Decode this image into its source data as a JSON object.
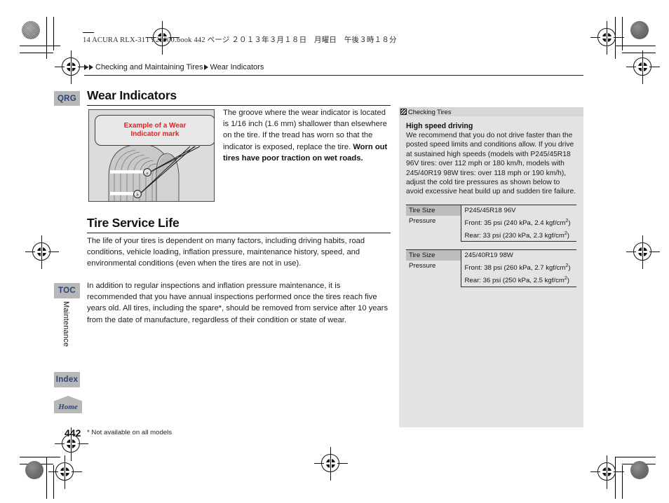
{
  "document": {
    "file_header": "14 ACURA RLX-31TY26000.book   442 ページ   ２０１３年３月１８日　月曜日　午後３時１８分",
    "page_number": "442",
    "footnote": "* Not available on all models",
    "vertical_tab": "Maintenance"
  },
  "breadcrumb": {
    "section": "Checking and Maintaining Tires",
    "topic": "Wear Indicators"
  },
  "sidenav": {
    "qrg": "QRG",
    "toc": "TOC",
    "index": "Index",
    "home": "Home",
    "badge_color": "#b7b7b7",
    "text_color": "#28447a"
  },
  "main": {
    "wear_indicators": {
      "title": "Wear Indicators",
      "figure": {
        "callout_line1": "Example of a Wear",
        "callout_line2": "Indicator mark",
        "callout_color": "#e8201e",
        "marker_a": "a",
        "marker_b": "b"
      },
      "paragraph": "The groove where the wear indicator is located is 1/16 inch (1.6 mm) shallower than elsewhere on the tire. If the tread has worn so that the indicator is exposed, replace the tire. ",
      "paragraph_bold": "Worn out tires have poor traction on wet roads."
    },
    "tire_service_life": {
      "title": "Tire Service Life",
      "paragraph_1": "The life of your tires is dependent on many factors, including driving habits, road conditions, vehicle loading, inflation pressure, maintenance history, speed, and environmental conditions (even when the tires are not in use).",
      "paragraph_2": "In addition to regular inspections and inflation pressure maintenance, it is recommended that you have annual inspections performed once the tires reach five years old. All tires, including the spare*, should be removed from service after 10 years from the date of manufacture, regardless of their condition or state of wear."
    }
  },
  "sidepanel": {
    "header_label": "Checking Tires",
    "heading": "High speed driving",
    "note": "We recommend that you do not drive faster than the posted speed limits and conditions allow. If you drive at sustained high speeds (models with P245/45R18 96V tires: over 112 mph or 180 km/h, models with 245/40R19 98W tires: over 118 mph or 190 km/h), adjust the cold tire pressures as shown below to avoid excessive heat build up and sudden tire failure.",
    "tables": [
      {
        "size_label": "Tire Size",
        "size_value": "P245/45R18 96V",
        "pressure_label": "Pressure",
        "pressure_front": "Front: 35 psi (240 kPa, 2.4 kgf/cm",
        "pressure_front_sup": "2",
        "pressure_front_end": ")",
        "pressure_rear": "Rear: 33 psi (230 kPa, 2.3 kgf/cm",
        "pressure_rear_sup": "2",
        "pressure_rear_end": ")"
      },
      {
        "size_label": "Tire Size",
        "size_value": "245/40R19 98W",
        "pressure_label": "Pressure",
        "pressure_front": "Front: 38 psi (260 kPa, 2.7 kgf/cm",
        "pressure_front_sup": "2",
        "pressure_front_end": ")",
        "pressure_rear": "Rear: 36 psi (250 kPa, 2.5 kgf/cm",
        "pressure_rear_sup": "2",
        "pressure_rear_end": ")"
      }
    ]
  }
}
